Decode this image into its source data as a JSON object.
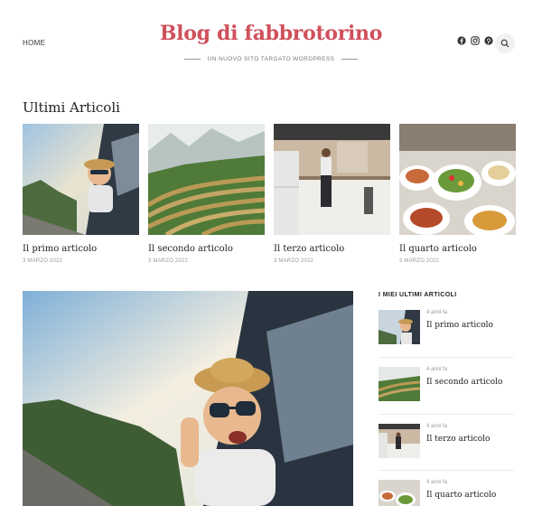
{
  "header": {
    "nav_home": "HOME",
    "site_title": "Blog di fabbrotorino",
    "tagline": "UN NUOVO SITO TARGATO WORDPRESS",
    "social_icons": [
      "facebook-icon",
      "instagram-icon",
      "pinterest-icon"
    ],
    "search_icon": "search-icon"
  },
  "section": {
    "title": "Ultimi Articoli"
  },
  "articles": [
    {
      "title": "Il primo articolo",
      "date": "3 MARZO 2022"
    },
    {
      "title": "Il secondo articolo",
      "date": "3 MARZO 2022"
    },
    {
      "title": "Il terzo articolo",
      "date": "3 MARZO 2022"
    },
    {
      "title": "Il quarto articolo",
      "date": "3 MARZO 2022"
    }
  ],
  "sidebar": {
    "title": "I MIEI ULTIMI ARTICOLI",
    "items": [
      {
        "meta": "4 anni fa",
        "title": "Il primo articolo"
      },
      {
        "meta": "4 anni fa",
        "title": "Il secondo articolo"
      },
      {
        "meta": "4 anni fa",
        "title": "Il terzo articolo"
      },
      {
        "meta": "4 anni fa",
        "title": "Il quarto articolo"
      }
    ]
  },
  "colors": {
    "accent": "#d0505c"
  }
}
